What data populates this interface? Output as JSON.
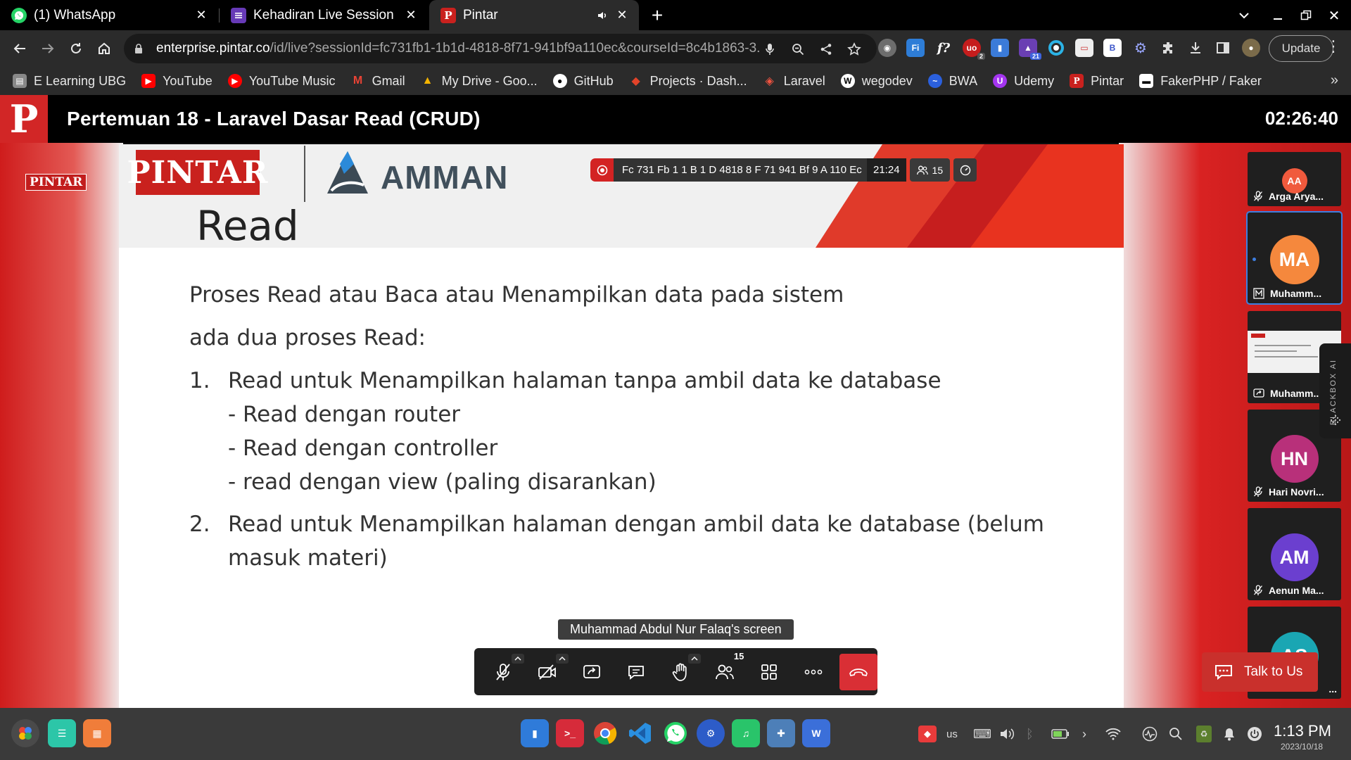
{
  "browser": {
    "tabs": [
      {
        "title": "(1) WhatsApp",
        "icon": "whatsapp-icon"
      },
      {
        "title": "Kehadiran Live Session Peserta",
        "icon": "forms-icon"
      },
      {
        "title": "Pintar",
        "icon": "pintar-icon"
      }
    ],
    "url_host": "enterprise.pintar.co",
    "url_path": "/id/live?sessionId=fc731fb1-1b1d-4818-8f71-941bf9a110ec&courseId=8c4b1863-3...",
    "update_label": "Update",
    "bookmarks": [
      {
        "label": "E Learning UBG",
        "color": "#888888"
      },
      {
        "label": "YouTube",
        "color": "#ff0000"
      },
      {
        "label": "YouTube Music",
        "color": "#ff0000"
      },
      {
        "label": "Gmail",
        "color": "#ea4335"
      },
      {
        "label": "My Drive - Goo...",
        "color": "#1fa463"
      },
      {
        "label": "GitHub",
        "color": "#333333"
      },
      {
        "label": "Projects · Dash...",
        "color": "#e24329"
      },
      {
        "label": "Laravel",
        "color": "#f05340"
      },
      {
        "label": "wegodev",
        "color": "#ffffff"
      },
      {
        "label": "BWA",
        "color": "#2b60de"
      },
      {
        "label": "Udemy",
        "color": "#a435f0"
      },
      {
        "label": "Pintar",
        "color": "#c9211e"
      },
      {
        "label": "FakerPHP / Faker",
        "color": "#ffffff"
      }
    ],
    "ext_badges": {
      "ext2": "2",
      "ext4": "21"
    }
  },
  "app": {
    "logo_letter": "P",
    "title": "Pertemuan 18 - Laravel Dasar Read (CRUD)",
    "timer": "02:26:40",
    "side_tag": "PINTAR"
  },
  "slide": {
    "brand_left": "PINTAR",
    "brand_right": "AMMAN",
    "title": "Read",
    "intro": "Proses Read atau Baca atau Menampilkan data pada sistem",
    "intro2": "ada dua proses Read:",
    "items": [
      {
        "num": "1.",
        "text": "Read untuk Menampilkan halaman tanpa ambil data ke database",
        "subs": [
          "- Read dengan router",
          "- Read dengan controller",
          "- read dengan view (paling disarankan)"
        ]
      },
      {
        "num": "2.",
        "text": "Read untuk Menampilkan halaman dengan ambil data ke database (belum masuk materi)"
      }
    ]
  },
  "meeting": {
    "id": "Fc 731 Fb 1 1 B 1 D 4818 8 F 71 941 Bf 9 A 110 Ec",
    "elapsed": "21:24",
    "participants_count": "15",
    "screen_label": "Muhammad Abdul Nur Falaq's screen",
    "participants_badge": "15",
    "talk_label": "Talk to Us",
    "blackbox_label": "BLACKBOX AI"
  },
  "participants": [
    {
      "initials": "AA",
      "name": "Arga Arya...",
      "color": "#f05a3d"
    },
    {
      "initials": "MA",
      "name": "Muhamm...",
      "color": "#f5883d"
    },
    {
      "initials": "",
      "name": "Muhamm..."
    },
    {
      "initials": "HN",
      "name": "Hari Novri...",
      "color": "#b8307a"
    },
    {
      "initials": "AM",
      "name": "Aenun Ma...",
      "color": "#6b3fcf"
    },
    {
      "initials": "AS",
      "name": "...",
      "color": "#1aa6b3"
    }
  ],
  "taskbar": {
    "layout": "us",
    "time": "1:13 PM",
    "date": "2023/10/18"
  }
}
